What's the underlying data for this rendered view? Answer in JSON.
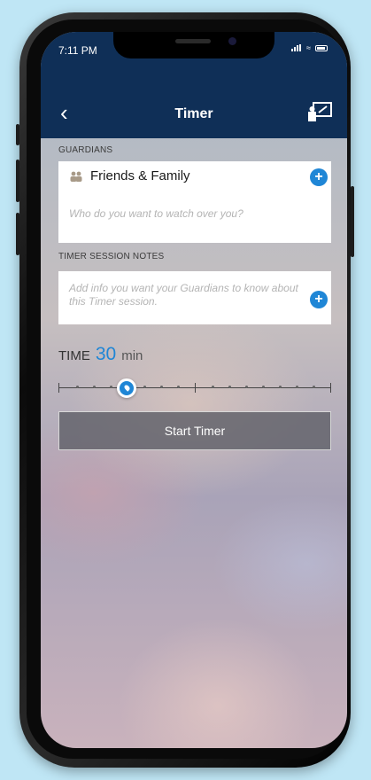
{
  "status_bar": {
    "time": "7:11 PM"
  },
  "nav": {
    "title": "Timer",
    "back_icon": "chevron-left-icon",
    "action_icon": "share-screen-icon"
  },
  "guardians": {
    "section_label": "GUARDIANS",
    "group_name": "Friends & Family",
    "placeholder": "Who do you want to watch over you?"
  },
  "notes": {
    "section_label": "TIMER SESSION NOTES",
    "placeholder": "Add info you want your Guardians to know about this Timer session."
  },
  "time": {
    "label": "TIME",
    "value": "30",
    "unit": "min"
  },
  "slider": {
    "value": 30
  },
  "start_button": {
    "label": "Start Timer"
  },
  "colors": {
    "header": "#0f2f57",
    "accent": "#1f86d6"
  }
}
